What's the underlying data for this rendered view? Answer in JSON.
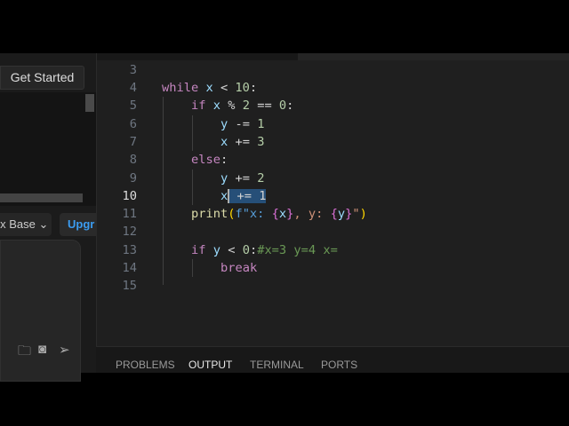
{
  "left_panel": {
    "get_started": "Get Started",
    "knowledge_base": "x Base",
    "knowledge_chevron": "⌄",
    "upgrade": "Upgr",
    "icons": [
      "folder-add-icon",
      "camera-icon",
      "send-icon"
    ]
  },
  "editor": {
    "current_line": 10,
    "lines": [
      {
        "n": "3"
      },
      {
        "n": "4"
      },
      {
        "n": "5"
      },
      {
        "n": "6"
      },
      {
        "n": "7"
      },
      {
        "n": "8"
      },
      {
        "n": "9"
      },
      {
        "n": "10"
      },
      {
        "n": "11"
      },
      {
        "n": "12"
      },
      {
        "n": "13"
      },
      {
        "n": "14"
      },
      {
        "n": "15"
      }
    ],
    "code": {
      "l4": [
        "while",
        " x ",
        "<",
        " 10",
        ":"
      ],
      "l5": [
        "if",
        " x ",
        "%",
        " 2 ",
        "==",
        " 0",
        ":"
      ],
      "l6": [
        "y",
        " -= ",
        "1"
      ],
      "l7": [
        "x",
        " += ",
        "3"
      ],
      "l8": [
        "else",
        ":"
      ],
      "l9": [
        "y",
        " += ",
        "2"
      ],
      "l10": [
        "x",
        " += 1"
      ],
      "l11": [
        "print",
        "(",
        "f\"x: ",
        "{",
        "x",
        "}",
        ", y: ",
        "{",
        "y",
        "}",
        "\"",
        ")"
      ],
      "l13": [
        "if",
        " y ",
        "<",
        " 0",
        ":",
        "#x=3 y=4 x="
      ],
      "l14": [
        "break"
      ]
    }
  },
  "panel": {
    "tabs": [
      "PROBLEMS",
      "OUTPUT",
      "TERMINAL",
      "PORTS"
    ],
    "active": "OUTPUT"
  }
}
